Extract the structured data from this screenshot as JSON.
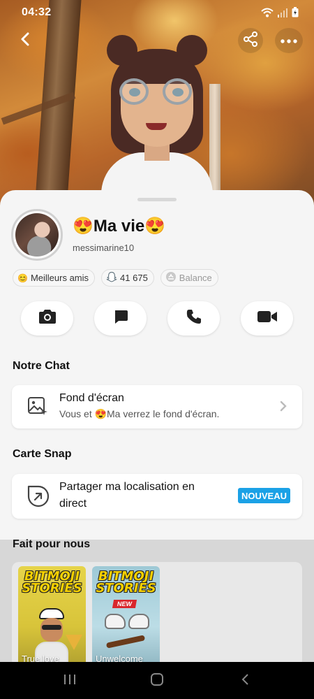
{
  "status_bar": {
    "time": "04:32"
  },
  "profile": {
    "display_name": "😍Ma vie😍",
    "username": "messimarine10"
  },
  "chips": [
    {
      "emoji": "😊",
      "label": "Meilleurs amis"
    },
    {
      "label": "41 675"
    },
    {
      "label": "Balance"
    }
  ],
  "sections": {
    "chat_title": "Notre Chat",
    "map_title": "Carte Snap",
    "stories_title": "Fait pour nous"
  },
  "wallpaper_card": {
    "title": "Fond d'écran",
    "subtitle": "Vous et 😍Ma verrez le fond d'écran."
  },
  "location_card": {
    "title_line1": "Partager ma localisation en",
    "title_line2": "direct",
    "badge": "NOUVEAU"
  },
  "stories": [
    {
      "logo_line1": "BITMOJI",
      "logo_line2": "STORIES",
      "caption": "True love"
    },
    {
      "logo_line1": "BITMOJI",
      "logo_line2": "STORIES",
      "tag": "NEW",
      "caption": "Unwelcome"
    }
  ],
  "colors": {
    "accent_badge": "#1ba1e6",
    "sheet_bg": "#f5f5f5"
  }
}
